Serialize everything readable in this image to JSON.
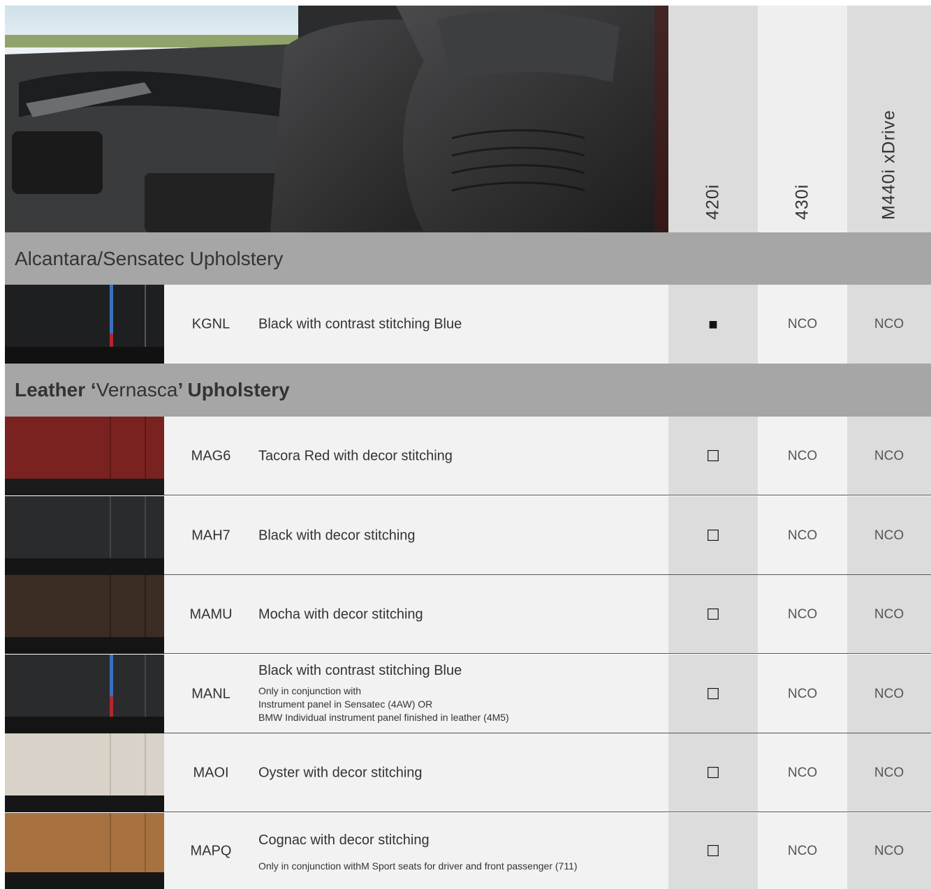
{
  "header": {
    "models": [
      "420i",
      "430i",
      "M440i xDrive"
    ]
  },
  "sections": {
    "alcantara": {
      "title": "Alcantara/Sensatec Upholstery"
    },
    "leather": {
      "title_bold_1": "Leather ‘",
      "title_thin": "Vernasca",
      "title_bold_2": "’ Upholstery"
    }
  },
  "rows": [
    {
      "code": "KGNL",
      "description": "Black with contrast stitching Blue",
      "note": "",
      "c420i": "■",
      "c430i": "NCO",
      "cM440i": "NCO",
      "swatch_color": "#1e1f21"
    },
    {
      "code": "MAG6",
      "description": "Tacora Red with decor stitching",
      "note": "",
      "c420i": "☐",
      "c430i": "NCO",
      "cM440i": "NCO",
      "swatch_color": "#7a2220"
    },
    {
      "code": "MAH7",
      "description": "Black with decor stitching",
      "note": "",
      "c420i": "☐",
      "c430i": "NCO",
      "cM440i": "NCO",
      "swatch_color": "#2a2b2c"
    },
    {
      "code": "MAMU",
      "description": "Mocha with decor stitching",
      "note": "",
      "c420i": "☐",
      "c430i": "NCO",
      "cM440i": "NCO",
      "swatch_color": "#3b2c24"
    },
    {
      "code": "MANL",
      "description": "Black with contrast stitching Blue",
      "note": "Only in conjunction with\nInstrument panel in Sensatec (4AW) OR\nBMW Individual instrument panel finished in leather (4M5)",
      "c420i": "☐",
      "c430i": "NCO",
      "cM440i": "NCO",
      "swatch_color": "#2a2b2d"
    },
    {
      "code": "MAOI",
      "description": "Oyster with decor stitching",
      "note": "",
      "c420i": "☐",
      "c430i": "NCO",
      "cM440i": "NCO",
      "swatch_color": "#d9d2c8"
    },
    {
      "code": "MAPQ",
      "description": "Cognac with decor stitching",
      "note": "Only in conjunction withM Sport seats for driver and front passenger (711)",
      "c420i": "☐",
      "c430i": "NCO",
      "cM440i": "NCO",
      "swatch_color": "#a7723f"
    }
  ]
}
